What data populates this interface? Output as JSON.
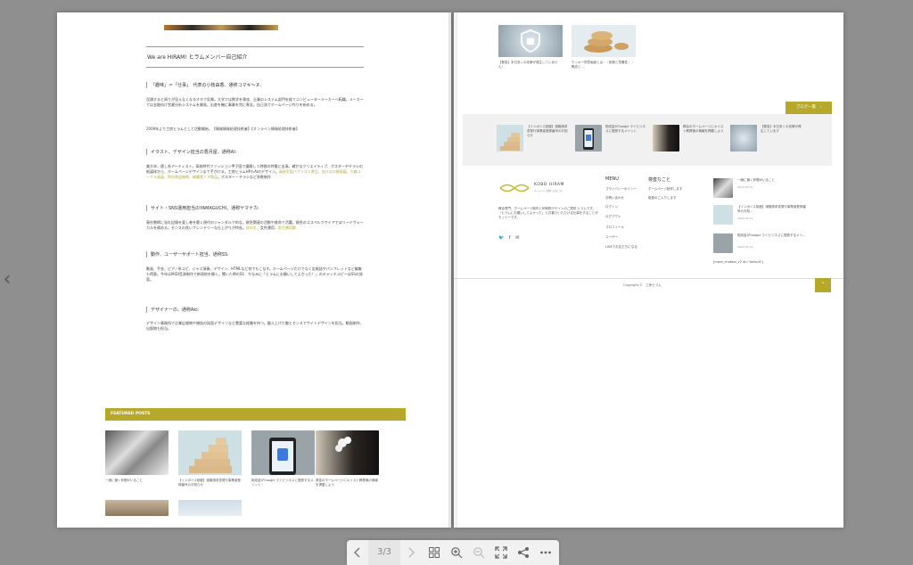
{
  "left": {
    "header_title": "We are HIRAM! ヒラムメンバー自己紹介",
    "sections": [
      {
        "title": "「趣味」＝「仕事」　代表の小枝由香、通称コマキ〜ヌ:",
        "body1": "没頭すると周りが見えなくなるオタク気質。大学では数学を専攻、企業のシステム部門を経てコンピューターメーカーへ転職。メーカーでは金融向け営業分析システムを開発。出産を機に事業を完に専念。自己流でホームページ作りを始める。",
        "body2": "2009年より工房ヒラムとして活動開始。【情報情報処理技術者】【オンライン情報処理技術者】"
      },
      {
        "title": "イラスト、デザイン担当の豊月屋、通称AI:",
        "body1": "美大卒、癒し系アーティスト。高校時代ファッション甲子園で優勝し１時間の特番に出演。確かなクリエイティブ、ポスターやチラシの紙媒体から、ホームページデザインまで手がける。工房ヒラムHPもAIのデザイン。",
        "body_hl": "高校学園パブリスト賞品、あけばの総画展、大森ユーナル画展、四谷商会総商、緑曜堂ノア商品",
        "body2": "。ポスター・チラシなど多数制作"
      },
      {
        "title": "サイト・SNS運用担当のYAMAGUCHI、通称ヤマナカ:",
        "body1": "専任教師に溢れ記憶を愛し巻を聴く現代のジャンダルク的な。救急関連の活動や救命で活躍。救急のゴスペルクワイアではリードヴォーカルを務める。センスの良いフレンドリーな仕上がりが特長。",
        "body_hl": "花の丸、",
        "body2": "女性運用、",
        "body_hl2": "家住運用館"
      },
      {
        "title": "動作、ユーザーサポート担当、通称SS:",
        "body1": "動画、手芸、ピアノ系コピ、ジャズ演奏、デザイン、HTMLなど何でもこなす。ホームページだけでなく広報誌やパンフレットなど編集も得意。今年はMIDI音源制作で新境地を開く。聞いた時のSS　ちなみに「ヒラムにお願いしてよかった！」のキャッチコピーはSSの発案。",
        "body2": ""
      },
      {
        "title": "デザイナーの、通称Aki:",
        "body1": "デザイン事務所で企業広報物や雑誌の誌面デザインなど豊富な経験を持つ。鍛え上げた腕とセンスでサイトデザインを担当。動画制作、出版物も担当。",
        "body2": ""
      }
    ],
    "featured": {
      "heading": "FEATURED POSTS",
      "posts": [
        {
          "caption": "一緒に働く仲間がいること"
        },
        {
          "caption": "【インボイス制度】適格請求書発行事業者登録番号のお知らせ"
        },
        {
          "caption": "助成金がGoogle マイビジネスに登録するメリット・"
        },
        {
          "caption": "救急のホームページにキリスト教葬儀の情報を掲載しよう"
        }
      ]
    }
  },
  "right": {
    "top_posts": [
      {
        "caption": "【緊急】本日多くの攻撃が発生していません！"
      },
      {
        "caption": "クッキー同意画面とは・・役割と意義性・・概念と…"
      }
    ],
    "blog_button": "ブログ一覧　›",
    "grid_posts": [
      {
        "caption": "【インボイス制度】適格請求書発行事業者登録番号のお知らせ"
      },
      {
        "caption": "助成金がGoogle マイビジネスに登録するメリット"
      },
      {
        "caption": "教会のホームページにキリスト教葬儀の情報を掲載しよう"
      },
      {
        "caption": "【緊急】本日多くの攻撃が発生しています"
      }
    ],
    "footer": {
      "logo_text": "KOBO HIRAM",
      "logo_sub": "ホームページ制作工房ヒラム",
      "about": "教会専門、ホームページ制作と印刷物デザインのご提供 ヒラムです。「ヒラムにお願いしてよかった」とお喜びいただける仕事をすることがモットーです。",
      "menu_heading": "MENU",
      "menu_items": [
        "プライバシーポリシー",
        "お問い合わせ",
        "ログイン",
        "ログアウト",
        "プロフィール",
        "ユーザー",
        "LINEでお友だちになる"
      ],
      "important_heading": "検査なこと",
      "important_items": [
        "ホームページ制作します",
        "取扱のご入りします"
      ],
      "recent": [
        {
          "caption": "一緒に働く仲間がいること",
          "date": "2023.03.15"
        },
        {
          "caption": "【インボイス制度】適格請求書発行事業者登録番号のお知...",
          "date": "2023.03.11"
        },
        {
          "caption": "助成金がGoogle マイビジネスに登録するメリ...",
          "date": "2023.03.11"
        }
      ],
      "shortcode": "[mwai_chatbot_v2 id=\"default\"]",
      "copyright": "Copyright ©　工房ヒラム"
    }
  },
  "toolbar": {
    "page_indicator": "3/3"
  },
  "colors": {
    "accent": "#b5a82a",
    "background": "#8f8f8f",
    "toolbar": "#f1f1f1"
  }
}
